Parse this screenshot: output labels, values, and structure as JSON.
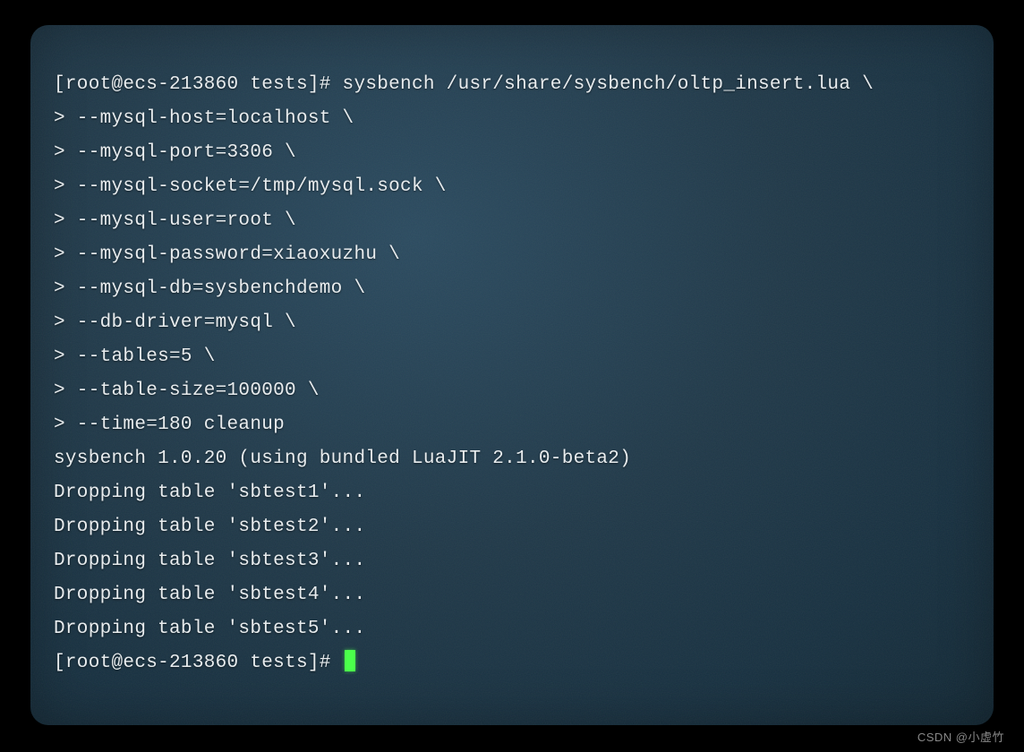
{
  "terminal": {
    "lines": [
      "[root@ecs-213860 tests]# sysbench /usr/share/sysbench/oltp_insert.lua \\",
      "> --mysql-host=localhost \\",
      "> --mysql-port=3306 \\",
      "> --mysql-socket=/tmp/mysql.sock \\",
      "> --mysql-user=root \\",
      "> --mysql-password=xiaoxuzhu \\",
      "> --mysql-db=sysbenchdemo \\",
      "> --db-driver=mysql \\",
      "> --tables=5 \\",
      "> --table-size=100000 \\",
      "> --time=180 cleanup",
      "sysbench 1.0.20 (using bundled LuaJIT 2.1.0-beta2)",
      "",
      "Dropping table 'sbtest1'...",
      "Dropping table 'sbtest2'...",
      "Dropping table 'sbtest3'...",
      "Dropping table 'sbtest4'...",
      "Dropping table 'sbtest5'..."
    ],
    "prompt": "[root@ecs-213860 tests]# "
  },
  "watermark": "CSDN @小虚竹"
}
